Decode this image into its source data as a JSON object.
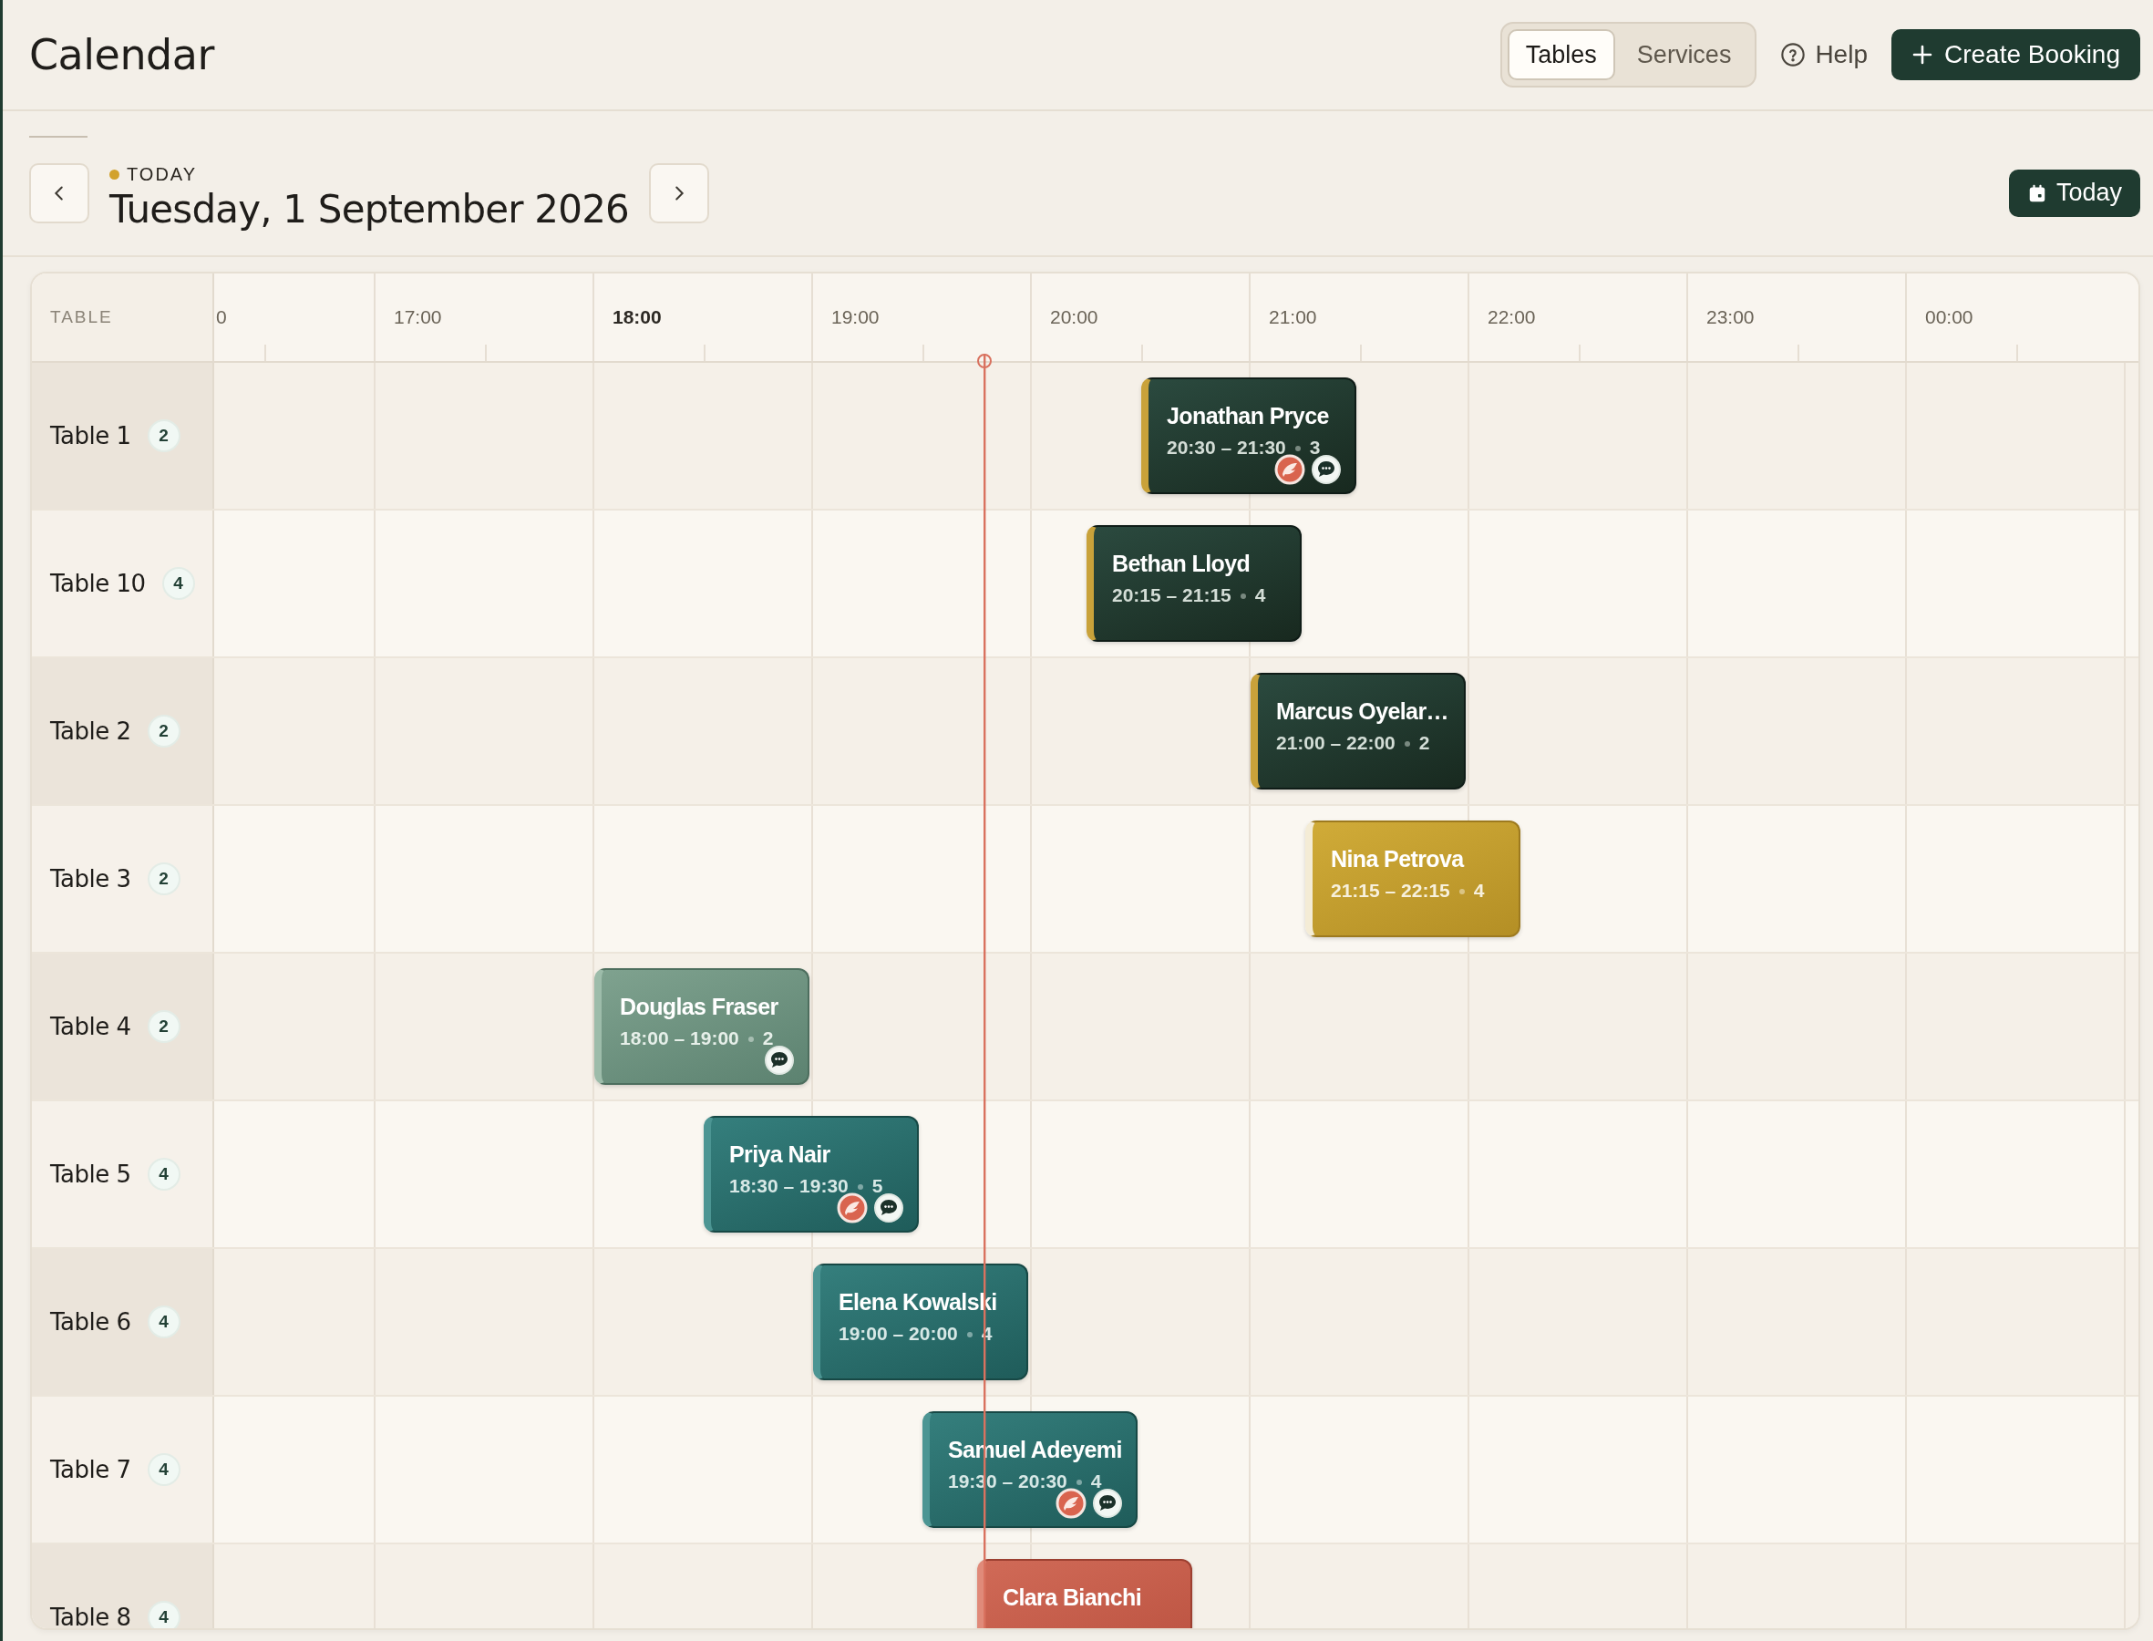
{
  "header": {
    "title": "Calendar",
    "view_toggle": [
      {
        "label": "Tables",
        "selected": true
      },
      {
        "label": "Services",
        "selected": false
      }
    ],
    "help": "Help",
    "create_button": "Create Booking"
  },
  "date_bar": {
    "today_badge": "TODAY",
    "date": "Tuesday, 1 September 2026",
    "today_button": "Today"
  },
  "grid": {
    "corner_label": "TABLE",
    "hours": [
      {
        "label": "0",
        "highlighted": false
      },
      {
        "label": "17:00",
        "highlighted": false
      },
      {
        "label": "18:00",
        "highlighted": true
      },
      {
        "label": "19:00",
        "highlighted": false
      },
      {
        "label": "20:00",
        "highlighted": false
      },
      {
        "label": "21:00",
        "highlighted": false
      },
      {
        "label": "22:00",
        "highlighted": false
      },
      {
        "label": "23:00",
        "highlighted": false
      },
      {
        "label": "00:00",
        "highlighted": false
      }
    ],
    "rows": [
      {
        "table": "Table 1",
        "seats": "2",
        "booking": {
          "kind": "dark",
          "name": "Jonathan Pryce",
          "time": "20:30 – 21:30",
          "party": "3",
          "dietary": true,
          "note": true
        }
      },
      {
        "table": "Table 10",
        "seats": "4",
        "booking": {
          "kind": "dark",
          "name": "Bethan Lloyd",
          "time": "20:15 – 21:15",
          "party": "4",
          "dietary": false,
          "note": false
        }
      },
      {
        "table": "Table 2",
        "seats": "2",
        "booking": {
          "kind": "dark",
          "name": "Marcus Oyelar…",
          "time": "21:00 – 22:00",
          "party": "2",
          "dietary": false,
          "note": false
        }
      },
      {
        "table": "Table 3",
        "seats": "2",
        "booking": {
          "kind": "gold",
          "name": "Nina Petrova",
          "time": "21:15 – 22:15",
          "party": "4",
          "dietary": false,
          "note": false
        }
      },
      {
        "table": "Table 4",
        "seats": "2",
        "booking": {
          "kind": "sage",
          "name": "Douglas Fraser",
          "time": "18:00 – 19:00",
          "party": "2",
          "dietary": false,
          "note": true
        }
      },
      {
        "table": "Table 5",
        "seats": "4",
        "booking": {
          "kind": "teal",
          "name": "Priya Nair",
          "time": "18:30 – 19:30",
          "party": "5",
          "dietary": true,
          "note": true
        }
      },
      {
        "table": "Table 6",
        "seats": "4",
        "booking": {
          "kind": "teal",
          "name": "Elena Kowalski",
          "time": "19:00 – 20:00",
          "party": "4",
          "dietary": false,
          "note": false
        }
      },
      {
        "table": "Table 7",
        "seats": "4",
        "booking": {
          "kind": "teal",
          "name": "Samuel Adeyemi",
          "time": "19:30 – 20:30",
          "party": "4",
          "dietary": true,
          "note": true
        }
      },
      {
        "table": "Table 8",
        "seats": "4",
        "booking": {
          "kind": "coral",
          "name": "Clara Bianchi",
          "dietary": false,
          "note": false
        }
      }
    ]
  }
}
